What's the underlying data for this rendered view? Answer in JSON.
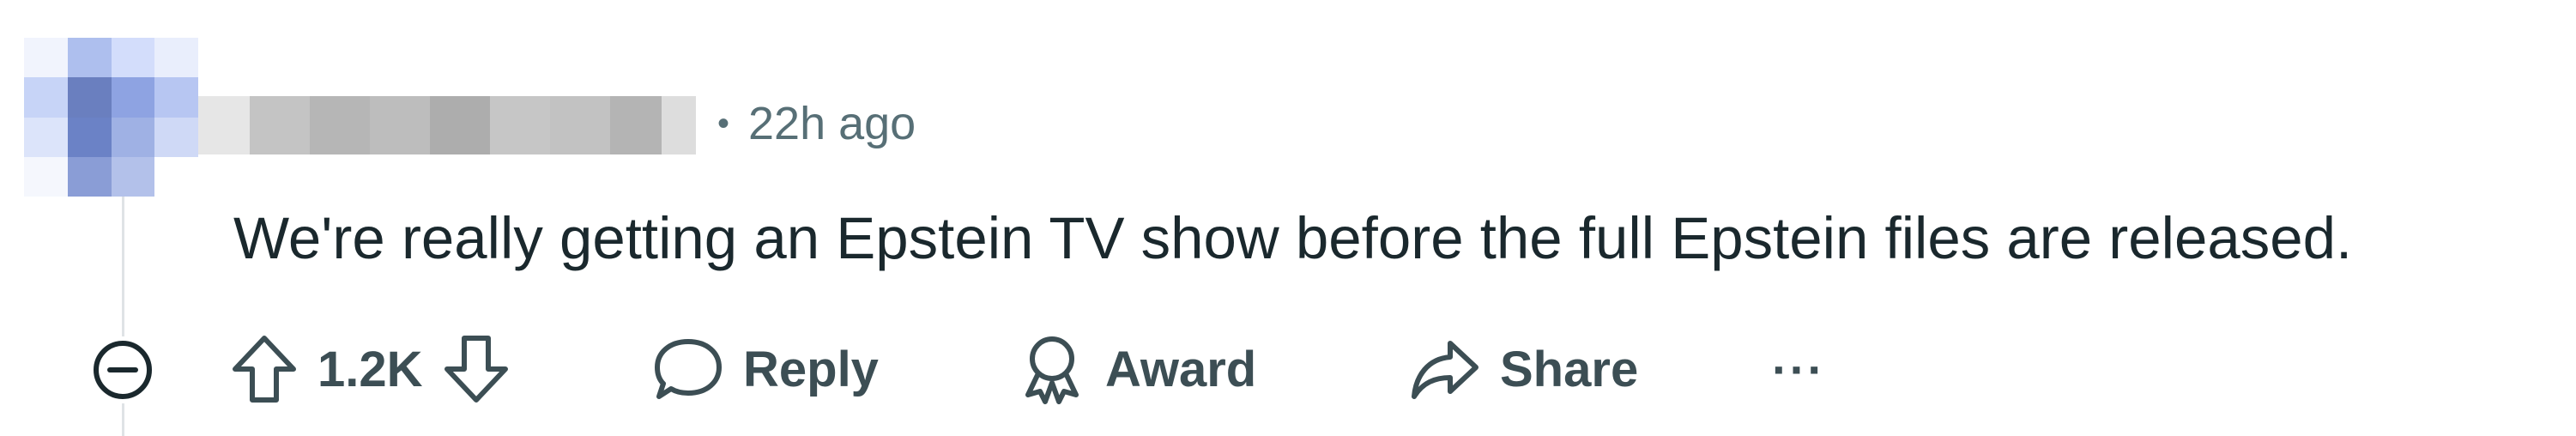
{
  "comment": {
    "avatar_icon": "pixelated-avatar",
    "username_icon": "pixelated-username",
    "separator": "•",
    "time": "22h ago",
    "body": "We're really getting an Epstein TV show before the full Epstein files are released."
  },
  "actions": {
    "collapse_icon": "collapse-minus-icon",
    "upvote_icon": "upvote-arrow-icon",
    "score": "1.2K",
    "downvote_icon": "downvote-arrow-icon",
    "reply_label": "Reply",
    "award_label": "Award",
    "share_label": "Share",
    "more_label": "···"
  },
  "colors": {
    "text_primary": "#1a282d",
    "text_secondary": "#576f76",
    "action_text": "#3c4e54",
    "thread_line": "#dfe3e6"
  }
}
